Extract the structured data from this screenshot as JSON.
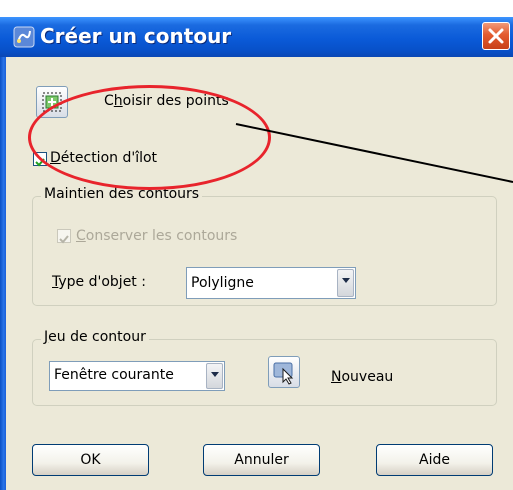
{
  "window": {
    "title": "Créer un contour",
    "close_icon": "close-icon"
  },
  "pick_points": {
    "icon": "pick-points-icon",
    "label_prefix": "C",
    "label_mnemonic": "h",
    "label_rest": "oisir des points"
  },
  "island_detection": {
    "checked": true,
    "label_mnemonic": "D",
    "label_rest": "étection d'îlot"
  },
  "boundary_retention": {
    "group_label": "Maintien des contours",
    "keep_boundaries": {
      "checked": true,
      "disabled": true,
      "label_mnemonic": "C",
      "label_rest": "onserver les contours"
    },
    "object_type": {
      "label_mnemonic": "T",
      "label_rest": "ype d'objet :",
      "value": "Polyligne"
    }
  },
  "boundary_set": {
    "group_label_mnemonic": "J",
    "group_label_rest": "eu de contour",
    "selected": "Fenêtre courante",
    "new_button": {
      "icon": "select-objects-icon",
      "label_mnemonic": "N",
      "label_rest": "ouveau"
    }
  },
  "buttons": {
    "ok": "OK",
    "cancel": "Annuler",
    "help": "Aide"
  },
  "annotation": {
    "shape": "ellipse-with-pointer-line",
    "color": "#e8242c",
    "line_color": "#000000"
  },
  "colors": {
    "titlebar": "#0a5ad8",
    "dialog_bg": "#ece9d8",
    "close_button": "#e35b2e"
  }
}
